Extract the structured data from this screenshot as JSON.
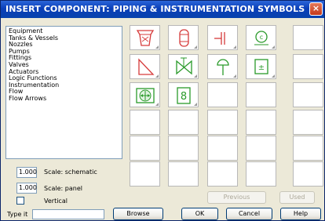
{
  "window": {
    "title": "INSERT COMPONENT: PIPING & INSTRUMENTATION SYMBOLS",
    "close": "×"
  },
  "categories": [
    "Equipment",
    "Tanks & Vessels",
    "Nozzles",
    "Pumps",
    "Fittings",
    "Valves",
    "Actuators",
    "Logic Functions",
    "Instrumentation",
    "Flow",
    "Flow Arrows"
  ],
  "symbols": [
    "hopper-symbol-icon",
    "vessel-symbol-icon",
    "flange-symbol-icon",
    "instrument-c-symbol-icon",
    "triangle-symbol-icon",
    "gate-valve-symbol-icon",
    "actuator-symbol-icon",
    "plus-minus-symbol-icon",
    "rotary-symbol-icon",
    "figure-eight-symbol-icon"
  ],
  "scale_schematic": {
    "value": "1.000",
    "label": "Scale: schematic"
  },
  "scale_panel": {
    "value": "1.000",
    "label": "Scale: panel"
  },
  "vertical": {
    "label": "Vertical",
    "checked": false
  },
  "type_it": {
    "label": "Type it",
    "value": ""
  },
  "buttons": {
    "previous": "Previous",
    "used": "Used",
    "browse": "Browse",
    "ok": "OK",
    "cancel": "Cancel",
    "help": "Help"
  },
  "colors": {
    "symbol_red": "#d63a3a",
    "symbol_green": "#2a9a2a",
    "titlebar": "#0a3fb8"
  }
}
